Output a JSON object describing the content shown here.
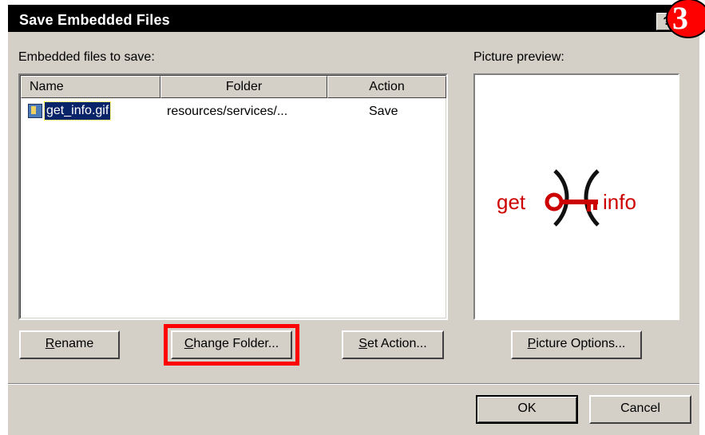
{
  "dialog": {
    "title": "Save Embedded Files",
    "help_label": "?",
    "step_badge": "3"
  },
  "file_list": {
    "label": "Embedded files to save:",
    "columns": [
      "Name",
      "Folder",
      "Action"
    ],
    "rows": [
      {
        "name": "get_info.gif",
        "folder": "resources/services/...",
        "action": "Save",
        "icon": "image-file-icon"
      }
    ]
  },
  "preview": {
    "label": "Picture preview:",
    "logo_left": "get",
    "logo_right": "info",
    "logo_color": "#cc0000"
  },
  "buttons": {
    "rename": {
      "underline": "R",
      "rest": "ename"
    },
    "change_folder": {
      "underline": "C",
      "rest": "hange Folder..."
    },
    "set_action": {
      "underline": "S",
      "rest": "et Action..."
    },
    "picture_options": {
      "underline": "P",
      "rest": "icture Options..."
    },
    "ok": "OK",
    "cancel": "Cancel"
  },
  "colors": {
    "dialog_bg": "#d4d0c8",
    "selection": "#0a246a",
    "highlight": "#ff0000"
  }
}
